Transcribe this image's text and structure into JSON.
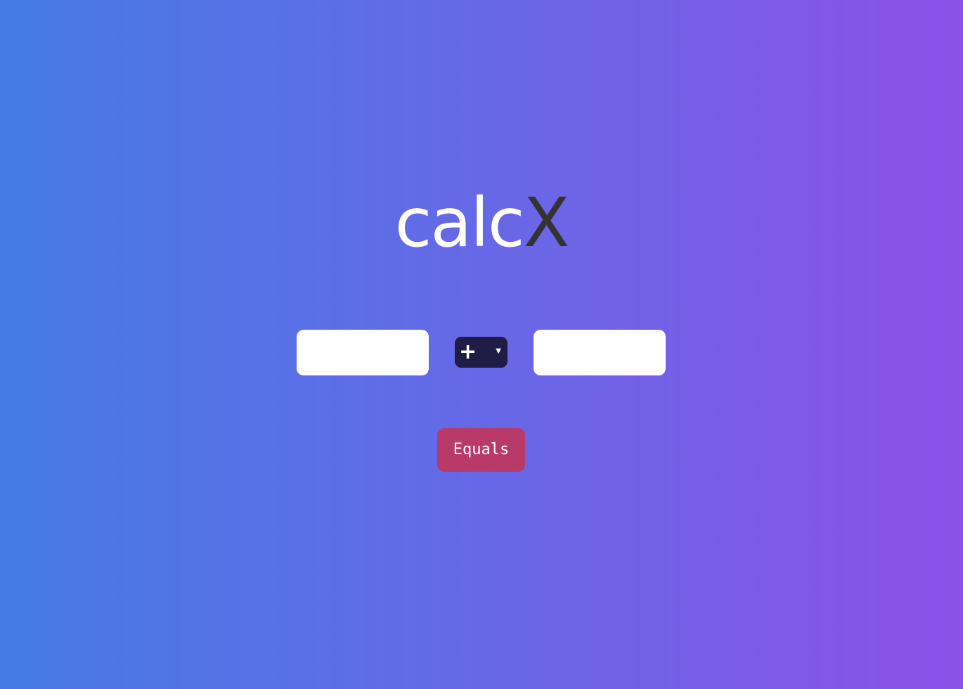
{
  "app": {
    "logo_part1": "calc",
    "logo_part2": "X"
  },
  "form": {
    "first_number": {
      "value": "",
      "placeholder": ""
    },
    "operator": {
      "selected": "+"
    },
    "second_number": {
      "value": "",
      "placeholder": ""
    },
    "equals_label": "Equals"
  },
  "icons": {
    "dropdown": "chevron-down-icon"
  },
  "colors": {
    "gradient_start": "#457be4",
    "gradient_end": "#8c51e8",
    "logo_accent": "#333333",
    "select_bg": "#1f1d45",
    "button_bg": "#b83a68"
  }
}
